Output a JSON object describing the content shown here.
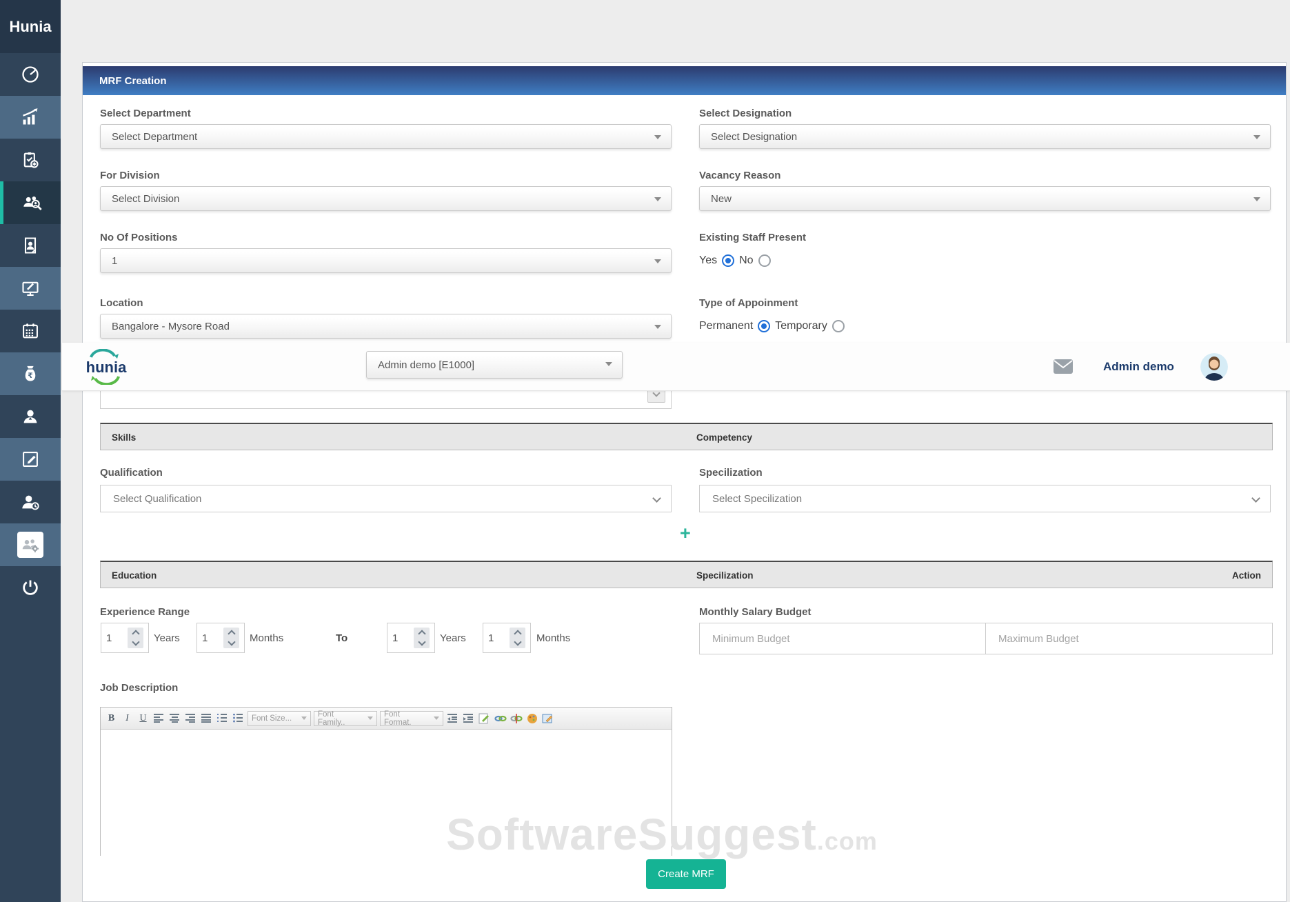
{
  "app": {
    "brand": "Hunia"
  },
  "sidebar": {
    "icons": [
      "dashboard-icon",
      "analytics-icon",
      "clipboard-add-icon",
      "recruitment-search-icon",
      "document-person-icon",
      "monitor-edit-icon",
      "calendar-icon",
      "payroll-money-bag-icon",
      "employee-icon",
      "edit-square-icon",
      "person-time-icon",
      "team-settings-icon",
      "power-icon"
    ],
    "active_item": "recruitment-search"
  },
  "topbar": {
    "logo_text": "hunia",
    "user_select_value": "Admin demo [E1000]",
    "user_name": "Admin demo"
  },
  "panel": {
    "title": "MRF Creation"
  },
  "form": {
    "department": {
      "label": "Select Department",
      "value": "Select Department"
    },
    "designation": {
      "label": "Select Designation",
      "value": "Select Designation"
    },
    "division": {
      "label": "For Division",
      "value": "Select Division"
    },
    "vacancy_reason": {
      "label": "Vacancy Reason",
      "value": "New"
    },
    "positions": {
      "label": "No Of Positions",
      "value": "1"
    },
    "existing_staff": {
      "label": "Existing Staff Present",
      "options": [
        "Yes",
        "No"
      ],
      "selected": "Yes"
    },
    "location": {
      "label": "Location",
      "value": "Bangalore - Mysore Road"
    },
    "appointment": {
      "label": "Type of Appoinment",
      "options": [
        "Permanent",
        "Temporary"
      ],
      "selected": "Permanent"
    },
    "skills_table": {
      "columns": [
        "Skills",
        "Competency"
      ]
    },
    "qualification": {
      "label": "Qualification",
      "value": "Select Qualification"
    },
    "specilization": {
      "label": "Specilization",
      "value": "Select Specilization"
    },
    "add_button": "+",
    "education_table": {
      "columns": [
        "Education",
        "Specilization",
        "Action"
      ]
    },
    "experience": {
      "label": "Experience Range",
      "from_years": "1",
      "from_months": "1",
      "to_years": "1",
      "to_months": "1",
      "years_label": "Years",
      "months_label": "Months",
      "separator": "To"
    },
    "salary": {
      "label": "Monthly Salary Budget",
      "min_placeholder": "Minimum Budget",
      "max_placeholder": "Maximum Budget"
    },
    "job_description": {
      "label": "Job Description",
      "toolbar": {
        "bold": "B",
        "italic": "I",
        "underline": "U",
        "font_size": "Font Size...",
        "font_family": "Font Family..",
        "font_format": "Font Format."
      }
    },
    "submit": "Create MRF"
  },
  "watermark": {
    "text": "SoftwareSuggest",
    "suffix": ".com"
  },
  "colors": {
    "accent_teal": "#1fbda6",
    "button_green": "#15b394",
    "radio_blue": "#2170d8",
    "header_gradient_top": "#2c3b6e",
    "header_gradient_bottom": "#3f7ec4",
    "sidebar_dark": "#304459",
    "sidebar_light": "#4d6a85"
  }
}
